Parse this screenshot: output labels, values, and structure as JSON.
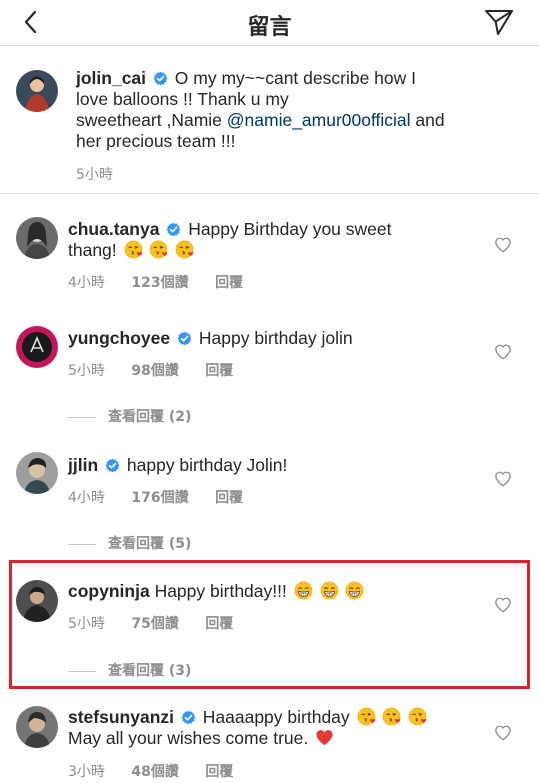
{
  "header": {
    "title": "留言"
  },
  "caption": {
    "username": "jolin_cai",
    "line1": "O my my~~cant describe how I",
    "line2": "love balloons !! Thank u my",
    "line3a": "sweetheart ,Namie ",
    "mention": "@namie_amur00official",
    "line3b": " and",
    "line4": "her precious team !!!",
    "time": "5小時"
  },
  "comments": [
    {
      "username": "chua.tanya",
      "text1": "Happy Birthday you sweet",
      "text2": "thang!",
      "time": "4小時",
      "likes": "123個讚",
      "reply": "回覆"
    },
    {
      "username": "yungchoyee",
      "text1": "Happy birthday jolin",
      "time": "5小時",
      "likes": "98個讚",
      "reply": "回覆",
      "view_replies": "查看回覆 (2)"
    },
    {
      "username": "jjlin",
      "text1": "happy birthday Jolin!",
      "time": "4小時",
      "likes": "176個讚",
      "reply": "回覆",
      "view_replies": "查看回覆 (5)"
    },
    {
      "username": "copyninja",
      "text1": "Happy birthday!!!",
      "time": "5小時",
      "likes": "75個讚",
      "reply": "回覆",
      "view_replies": "查看回覆 (3)"
    },
    {
      "username": "stefsunyanzi",
      "text1": "Haaaappy birthday",
      "text2": "May all your wishes come true.",
      "time": "3小時",
      "likes": "48個讚",
      "reply": "回覆"
    }
  ],
  "colors": {
    "verified": "#3897f0",
    "highlight": "#d8232a",
    "mention": "#003569",
    "meta": "#8e8e8e"
  }
}
